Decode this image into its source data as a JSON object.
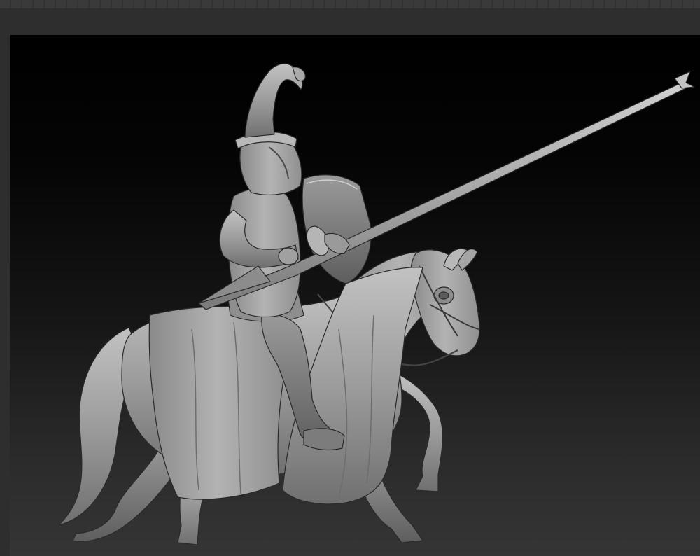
{
  "document": {
    "viewport_model": "mounted-knight-sculpt"
  },
  "colors": {
    "canvas_top": "#000000",
    "canvas_bottom": "#353535",
    "chrome": "#2e2e2e",
    "clay": "#9a9a9a"
  },
  "icons": {
    "model": "knight-on-horse-figure"
  }
}
